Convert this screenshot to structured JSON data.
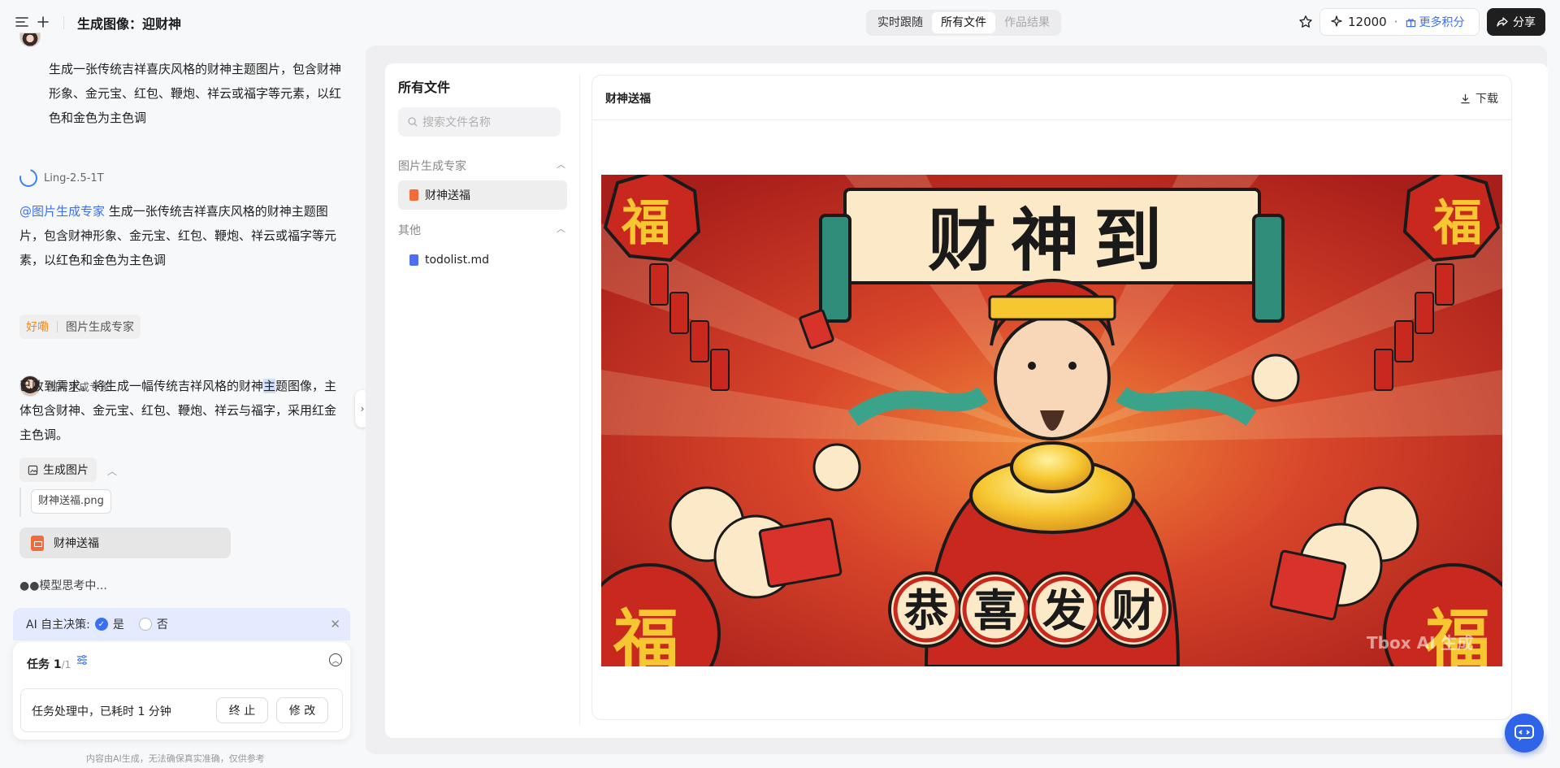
{
  "header": {
    "title": "生成图像：迎财神",
    "tabs": [
      {
        "label": "实时跟随",
        "state": "normal"
      },
      {
        "label": "所有文件",
        "state": "active"
      },
      {
        "label": "作品结果",
        "state": "disabled"
      }
    ],
    "credits": "12000",
    "more_credits": "更多积分",
    "share": "分享"
  },
  "chat": {
    "user_prompt": "生成一张传统吉祥喜庆风格的财神主题图片，包含财神形象、金元宝、红包、鞭炮、祥云或福字等元素，以红色和金色为主色调",
    "model_name": "Ling-2.5-1T",
    "mention": "@图片生成专家",
    "forward_text": "生成一张传统吉祥喜庆风格的财神主题图片，包含财神形象、金元宝、红包、鞭炮、祥云或福字等元素，以红色和金色为主色调",
    "chip_ok": "好嘞",
    "chip_expert": "图片生成专家",
    "expert_name": "图片生成专家",
    "reply_pre": "已收到需求。将生成一幅传统吉祥风格的财神",
    "reply_sel": "主",
    "reply_post": "题图像，主体包含财神、金元宝、红包、鞭炮、祥云与福字，采用红金主色调。",
    "gen_button": "生成图片",
    "file_chip": "财神送福.png",
    "file_card": "财神送福",
    "thinking": "●●模型思考中..."
  },
  "ai_decision": {
    "label": "AI 自主决策:",
    "yes": "是",
    "no": "否"
  },
  "task": {
    "title": "任务 1",
    "fraction": "/1",
    "status": "任务处理中，已耗时 1 分钟",
    "stop": "终 止",
    "modify": "修 改"
  },
  "footer_note": "内容由AI生成，无法确保真实准确，仅供参考",
  "files": {
    "title": "所有文件",
    "search_placeholder": "搜索文件名称",
    "groups": [
      {
        "name": "图片生成专家",
        "items": [
          "财神送福"
        ]
      },
      {
        "name": "其他",
        "items": [
          "todolist.md"
        ]
      }
    ]
  },
  "viewer": {
    "title": "财神送福",
    "download": "下载",
    "art_banner": "财神到",
    "art_coins": [
      "恭",
      "喜",
      "发",
      "财"
    ],
    "art_fu": "福",
    "watermark": "Tbox AI 生成"
  },
  "colors": {
    "accent": "#3b6ff5",
    "dark_button": "#1f1f1f",
    "art_red": "#c8281e",
    "art_gold": "#f2c230"
  }
}
